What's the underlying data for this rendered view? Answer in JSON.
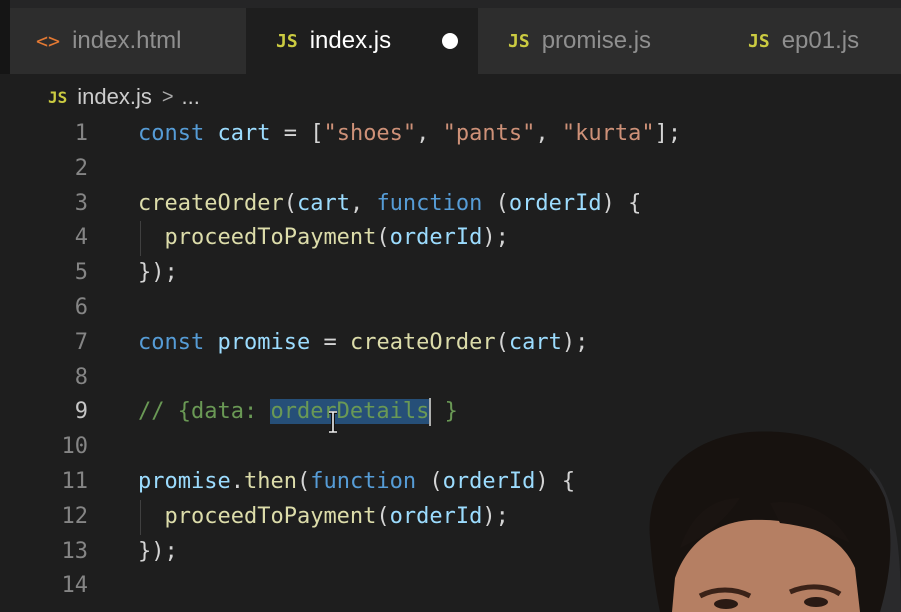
{
  "tabs": [
    {
      "icon": "<>",
      "label": "index.html"
    },
    {
      "icon": "JS",
      "label": "index.js"
    },
    {
      "icon": "JS",
      "label": "promise.js"
    },
    {
      "icon": "JS",
      "label": "ep01.js"
    }
  ],
  "breadcrumb": {
    "icon": "JS",
    "file": "index.js",
    "sep": ">",
    "more": "..."
  },
  "editor": {
    "line_numbers": [
      "1",
      "2",
      "3",
      "4",
      "5",
      "6",
      "7",
      "8",
      "9",
      "10",
      "11",
      "12",
      "13",
      "14"
    ],
    "lines": [
      [
        {
          "t": "const",
          "c": "kw"
        },
        {
          "t": " ",
          "c": ""
        },
        {
          "t": "cart",
          "c": "var"
        },
        {
          "t": " = [",
          "c": ""
        },
        {
          "t": "\"shoes\"",
          "c": "str"
        },
        {
          "t": ", ",
          "c": ""
        },
        {
          "t": "\"pants\"",
          "c": "str"
        },
        {
          "t": ", ",
          "c": ""
        },
        {
          "t": "\"kurta\"",
          "c": "str"
        },
        {
          "t": "];",
          "c": ""
        }
      ],
      [],
      [
        {
          "t": "createOrder",
          "c": "fn"
        },
        {
          "t": "(",
          "c": ""
        },
        {
          "t": "cart",
          "c": "var"
        },
        {
          "t": ", ",
          "c": ""
        },
        {
          "t": "function",
          "c": "kw"
        },
        {
          "t": " (",
          "c": ""
        },
        {
          "t": "orderId",
          "c": "var"
        },
        {
          "t": ") {",
          "c": ""
        }
      ],
      [
        {
          "t": "  ",
          "c": ""
        },
        {
          "t": "proceedToPayment",
          "c": "fn"
        },
        {
          "t": "(",
          "c": ""
        },
        {
          "t": "orderId",
          "c": "var"
        },
        {
          "t": ");",
          "c": ""
        }
      ],
      [
        {
          "t": "});",
          "c": ""
        }
      ],
      [],
      [
        {
          "t": "const",
          "c": "kw"
        },
        {
          "t": " ",
          "c": ""
        },
        {
          "t": "promise",
          "c": "var"
        },
        {
          "t": " = ",
          "c": ""
        },
        {
          "t": "createOrder",
          "c": "fn"
        },
        {
          "t": "(",
          "c": ""
        },
        {
          "t": "cart",
          "c": "var"
        },
        {
          "t": ");",
          "c": ""
        }
      ],
      [],
      [
        {
          "t": "// {data: ",
          "c": "cm"
        },
        {
          "t": "orderDetails",
          "c": "cm sel"
        },
        {
          "t": "",
          "c": "caret"
        },
        {
          "t": " }",
          "c": "cm"
        }
      ],
      [],
      [
        {
          "t": "promise",
          "c": "var"
        },
        {
          "t": ".",
          "c": ""
        },
        {
          "t": "then",
          "c": "fn"
        },
        {
          "t": "(",
          "c": ""
        },
        {
          "t": "function",
          "c": "kw"
        },
        {
          "t": " (",
          "c": ""
        },
        {
          "t": "orderId",
          "c": "var"
        },
        {
          "t": ") {",
          "c": ""
        }
      ],
      [
        {
          "t": "  ",
          "c": ""
        },
        {
          "t": "proceedToPayment",
          "c": "fn"
        },
        {
          "t": "(",
          "c": ""
        },
        {
          "t": "orderId",
          "c": "var"
        },
        {
          "t": ");",
          "c": ""
        }
      ],
      [
        {
          "t": "});",
          "c": ""
        }
      ],
      []
    ],
    "current_line": 9
  },
  "colors": {
    "keyword": "#569cd6",
    "variable": "#9cdcfe",
    "function": "#dcdcaa",
    "string": "#ce9178",
    "comment": "#6a9955",
    "selection": "#264f78"
  }
}
